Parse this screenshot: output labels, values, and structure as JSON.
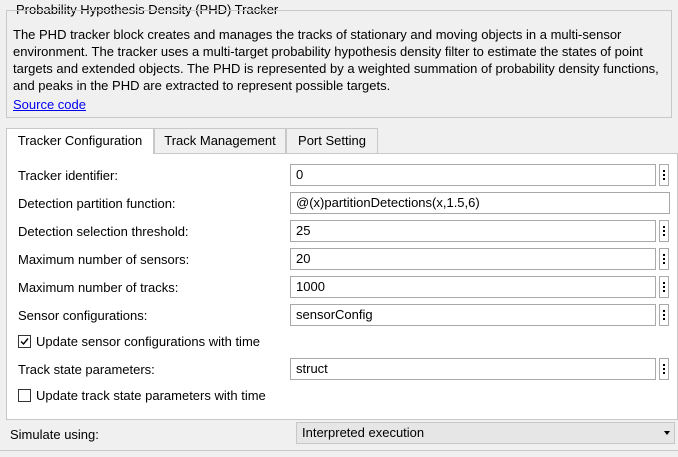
{
  "header": {
    "title": "Probability Hypothesis Density (PHD) Tracker",
    "description": "The PHD tracker block creates and manages the tracks of stationary and moving objects in a multi-sensor environment. The tracker uses a multi-target probability hypothesis density filter to estimate the states of point targets and extended objects. The PHD is represented by a weighted summation of probability density functions, and peaks in the PHD are extracted to represent possible targets.",
    "source_link": "Source code"
  },
  "tabs": [
    {
      "label": "Tracker Configuration",
      "active": true
    },
    {
      "label": "Track Management",
      "active": false
    },
    {
      "label": "Port Setting",
      "active": false
    }
  ],
  "fields": {
    "tracker_identifier": {
      "label": "Tracker identifier:",
      "value": "0"
    },
    "detection_partition_function": {
      "label": "Detection partition function:",
      "value": "@(x)partitionDetections(x,1.5,6)"
    },
    "detection_selection_threshold": {
      "label": "Detection selection threshold:",
      "value": "25"
    },
    "max_sensors": {
      "label": "Maximum number of sensors:",
      "value": "20"
    },
    "max_tracks": {
      "label": "Maximum number of tracks:",
      "value": "1000"
    },
    "sensor_configurations": {
      "label": "Sensor configurations:",
      "value": "sensorConfig"
    },
    "track_state_parameters": {
      "label": "Track state parameters:",
      "value": "struct"
    }
  },
  "checkboxes": {
    "update_sensor_configs": {
      "label": "Update sensor configurations with time",
      "checked": true
    },
    "update_track_state_params": {
      "label": "Update track state parameters with time",
      "checked": false
    }
  },
  "simulate": {
    "label": "Simulate using:",
    "selected": "Interpreted execution"
  }
}
